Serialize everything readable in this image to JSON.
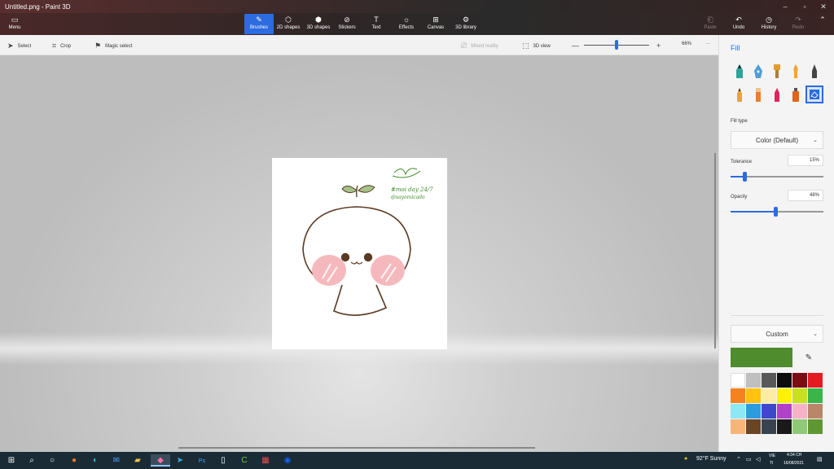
{
  "window": {
    "title": "Untitled.png - Paint 3D"
  },
  "toolbar": {
    "menu": "Menu",
    "tools": [
      {
        "label": "Brushes",
        "icon": "brush-icon",
        "glyph": "✎"
      },
      {
        "label": "2D shapes",
        "icon": "2d-shapes-icon",
        "glyph": "⬡"
      },
      {
        "label": "3D shapes",
        "icon": "3d-shapes-icon",
        "glyph": "⬢"
      },
      {
        "label": "Stickers",
        "icon": "stickers-icon",
        "glyph": "⊘"
      },
      {
        "label": "Text",
        "icon": "text-icon",
        "glyph": "T"
      },
      {
        "label": "Effects",
        "icon": "effects-icon",
        "glyph": "☼"
      },
      {
        "label": "Canvas",
        "icon": "canvas-icon",
        "glyph": "⊞"
      },
      {
        "label": "3D library",
        "icon": "3d-library-icon",
        "glyph": "⚙"
      }
    ],
    "paste": "Paste",
    "undo": "Undo",
    "history": "History",
    "redo": "Redo"
  },
  "subbar": {
    "select": "Select",
    "crop": "Crop",
    "magic_select": "Magic select",
    "mixed_reality": "Mixed reality",
    "view3d": "3D view",
    "zoom": "66%",
    "zoom_level": 0.5,
    "more": "···"
  },
  "panel": {
    "title": "Fill",
    "fill_type_label": "Fill type",
    "fill_type_value": "Color (Default)",
    "tolerance_label": "Tolerance",
    "tolerance_value": "15%",
    "tolerance_level": 0.15,
    "opacity_label": "Opacity",
    "opacity_value": "48%",
    "opacity_level": 0.48,
    "custom": "Custom",
    "selected_color": "#4e8c2e",
    "palette": [
      "#ffffff",
      "#bfbfbf",
      "#595959",
      "#0d0d0d",
      "#7a0c14",
      "#e31b23",
      "#f58220",
      "#ffc20e",
      "#fdeca6",
      "#fff200",
      "#c9e01f",
      "#39b54a",
      "#8ee7f4",
      "#2e9bdf",
      "#3f48cc",
      "#b241c9",
      "#f7b2c8",
      "#b9866a",
      "#f7b57a",
      "#6b4423",
      "#38434f",
      "#1a1a1a",
      "#8fc877",
      "#5f9833"
    ]
  },
  "drawing": {
    "signature": "Ly",
    "hashtag": "#moi day 24/7",
    "handle": "@sayomicado"
  },
  "taskbar": {
    "weather": "92°F Sunny",
    "lang": "VIE",
    "lang2": "TI",
    "time": "4:34 CH",
    "date": "16/08/2021"
  }
}
